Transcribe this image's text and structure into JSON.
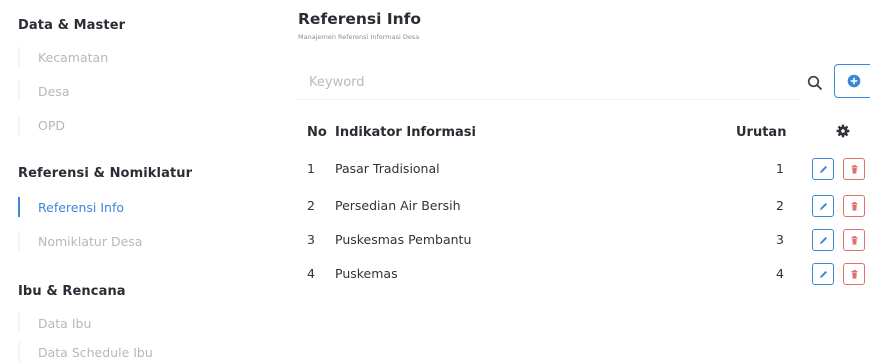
{
  "sidebar": {
    "groups": [
      {
        "title": "Data & Master",
        "items": [
          "Kecamatan",
          "Desa",
          "OPD"
        ]
      },
      {
        "title": "Referensi & Nomiklatur",
        "items": [
          "Referensi Info",
          "Nomiklatur Desa"
        ]
      },
      {
        "title": "Ibu & Rencana",
        "items": [
          "Data Ibu",
          "Data Schedule Ibu"
        ]
      }
    ],
    "active_item": "Referensi Info"
  },
  "header": {
    "title": "Referensi Info",
    "subtitle": "Manajemen Referensi Informasi Desa"
  },
  "search": {
    "placeholder": "Keyword",
    "value": "",
    "icon": "search-icon"
  },
  "toolbar": {
    "add_icon": "plus-circle-icon"
  },
  "table": {
    "columns": {
      "no": "No",
      "name": "Indikator Informasi",
      "order": "Urutan",
      "actions_icon": "gear-icon"
    },
    "rows": [
      {
        "no": "1",
        "name": "Pasar Tradisional",
        "order": "1"
      },
      {
        "no": "2",
        "name": "Persedian Air Bersih",
        "order": "2"
      },
      {
        "no": "3",
        "name": "Puskesmas Pembantu",
        "order": "3"
      },
      {
        "no": "4",
        "name": "Puskemas",
        "order": "4"
      }
    ],
    "row_actions": {
      "edit_icon": "pencil-icon",
      "delete_icon": "trash-icon"
    }
  },
  "colors": {
    "accent": "#3c86d8",
    "danger": "#e0706c",
    "muted_text": "#b4b8be",
    "heading_text": "#2a2d33"
  }
}
